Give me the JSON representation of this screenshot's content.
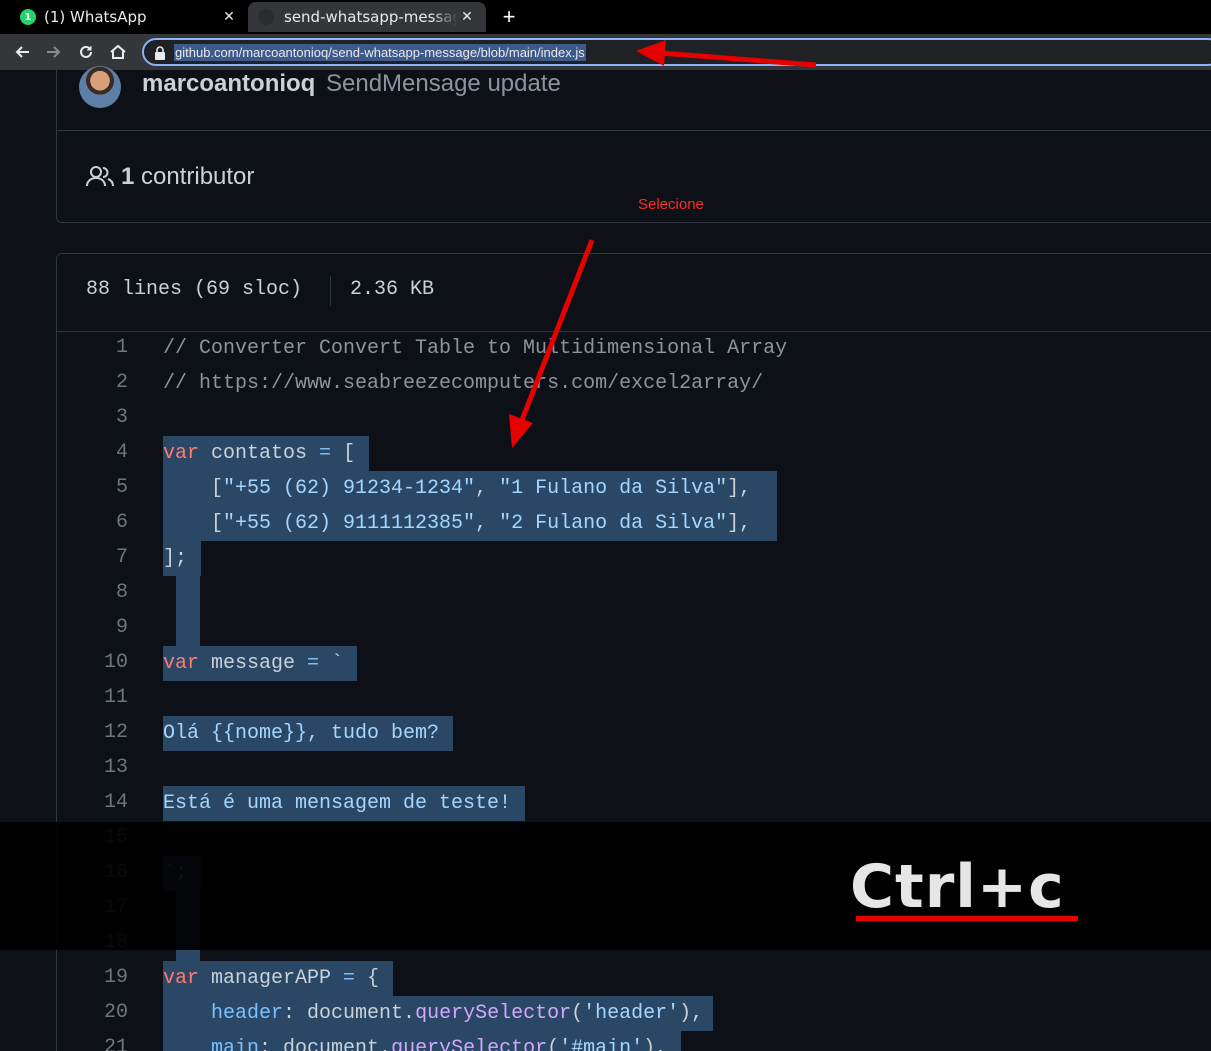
{
  "browser": {
    "tabs": [
      {
        "title": "(1) WhatsApp",
        "badge": "1",
        "active": false
      },
      {
        "title": "send-whatsapp-message",
        "active": true
      }
    ],
    "close_glyph": "✕",
    "new_tab_glyph": "+",
    "url": "github.com/marcoantonioq/send-whatsapp-message/blob/main/index.js"
  },
  "commit": {
    "author": "marcoantonioq",
    "message": "SendMensage update"
  },
  "contributors": {
    "count": "1",
    "label": "contributor"
  },
  "file": {
    "lines_info": "88 lines (69 sloc)",
    "size": "2.36 KB"
  },
  "code_lines": [
    {
      "n": "1",
      "text": "// Converter Convert Table to Multidimensional Array"
    },
    {
      "n": "2",
      "text": "// https://www.seabreezecomputers.com/excel2array/"
    },
    {
      "n": "3",
      "text": ""
    },
    {
      "n": "4",
      "text": "var contatos = ["
    },
    {
      "n": "5",
      "text": "    [\"+55 (62) 91234-1234\", \"1 Fulano da Silva\"],"
    },
    {
      "n": "6",
      "text": "    [\"+55 (62) 9111112385\", \"2 Fulano da Silva\"],"
    },
    {
      "n": "7",
      "text": "];"
    },
    {
      "n": "8",
      "text": ""
    },
    {
      "n": "9",
      "text": ""
    },
    {
      "n": "10",
      "text": "var message = `"
    },
    {
      "n": "11",
      "text": ""
    },
    {
      "n": "12",
      "text": "Olá {{nome}}, tudo bem?"
    },
    {
      "n": "13",
      "text": ""
    },
    {
      "n": "14",
      "text": "Está é uma mensagem de teste!"
    },
    {
      "n": "15",
      "text": ""
    },
    {
      "n": "16",
      "text": "`;"
    },
    {
      "n": "17",
      "text": ""
    },
    {
      "n": "18",
      "text": ""
    },
    {
      "n": "19",
      "text": "var managerAPP = {"
    },
    {
      "n": "20",
      "text": "    header: document.querySelector('header'),"
    },
    {
      "n": "21",
      "text": "    main: document.querySelector('#main'),"
    }
  ],
  "annotations": {
    "hint": "Selecione",
    "shortcut": "Ctrl+c",
    "arrow_color": "#e60000"
  },
  "theme": {
    "background": "#0d1117",
    "selection": "#2a4866",
    "keyword": "#ff7b72",
    "string": "#a5d6ff",
    "function": "#d2a8ff"
  }
}
